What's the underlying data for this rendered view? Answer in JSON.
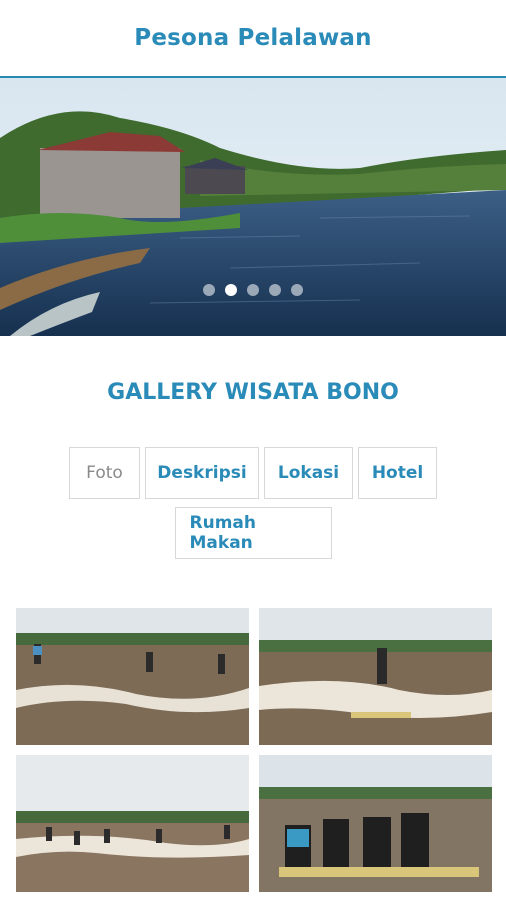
{
  "header": {
    "title": "Pesona Pelalawan"
  },
  "carousel": {
    "slide_count": 5,
    "active_index": 1
  },
  "gallery_section": {
    "title": "GALLERY WISATA BONO"
  },
  "tabs": [
    {
      "label": "Foto",
      "active": true
    },
    {
      "label": "Deskripsi",
      "active": false
    },
    {
      "label": "Lokasi",
      "active": false
    },
    {
      "label": "Hotel",
      "active": false
    },
    {
      "label": "Rumah Makan",
      "active": false
    }
  ],
  "photos": [
    {
      "subject": "river-surfers-wave"
    },
    {
      "subject": "single-surfer-wave"
    },
    {
      "subject": "group-surfers-distance"
    },
    {
      "subject": "four-surfers-posing"
    }
  ],
  "colors": {
    "accent": "#2a8bb8",
    "water": "#1f3f63"
  }
}
